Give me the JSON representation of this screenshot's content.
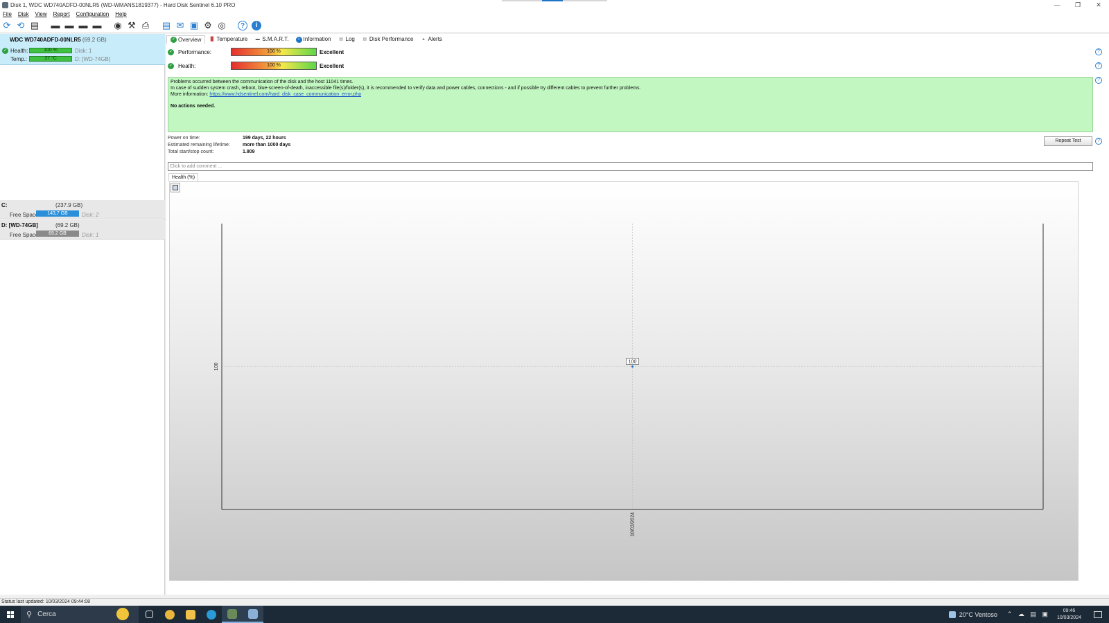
{
  "window": {
    "title": "Disk 1, WDC WD740ADFD-00NLR5 (WD-WMANS1819377) - Hard Disk Sentinel 6.10 PRO"
  },
  "menu": [
    "File",
    "Disk",
    "View",
    "Report",
    "Configuration",
    "Help"
  ],
  "disk": {
    "name": "WDC WD740ADFD-00NLR5",
    "size": "(69.2 GB)",
    "health_label": "Health:",
    "health_value": "100 %",
    "health_percent": 100,
    "disk_label": "Disk: 1",
    "temp_label": "Temp.:",
    "temp_value": "37 °C",
    "temp_drive": "D: [WD-74GB]"
  },
  "volumes": [
    {
      "name": "C:",
      "size": "(237.9 GB)",
      "free_label": "Free Space",
      "free_value": "143,7 GB",
      "disk": "Disk: 2",
      "bar_color": "#2a8fd8"
    },
    {
      "name": "D: [WD-74GB]",
      "size": "(69.2 GB)",
      "free_label": "Free Space",
      "free_value": "69,2 GB",
      "disk": "Disk: 1",
      "bar_color": "#8a8a8a"
    }
  ],
  "tabs": [
    {
      "label": "Overview",
      "icon": "check-icon",
      "color": "#2ea043"
    },
    {
      "label": "Temperature",
      "icon": "thermometer-icon",
      "color": "#c44"
    },
    {
      "label": "S.M.A.R.T.",
      "icon": "drive-icon",
      "color": "#555"
    },
    {
      "label": "Information",
      "icon": "info-icon",
      "color": "#1e74c8"
    },
    {
      "label": "Log",
      "icon": "log-icon",
      "color": "#888"
    },
    {
      "label": "Disk Performance",
      "icon": "performance-icon",
      "color": "#888"
    },
    {
      "label": "Alerts",
      "icon": "alert-icon",
      "color": "#888"
    }
  ],
  "overview": {
    "performance_label": "Performance:",
    "performance_bar": "100 %",
    "performance_percent": 100,
    "performance_text": "Excellent",
    "health_label": "Health:",
    "health_bar": "100 %",
    "health_percent": 100,
    "health_text": "Excellent",
    "message_line1": "Problems occurred between the communication of the disk and the host 11041 times.",
    "message_line2": "In case of sudden system crash, reboot, blue-screen-of-death, inaccessible file(s)/folder(s), it is recommended to verify data and power cables, connections - and if possible try different cables to prevent further problems.",
    "message_more_label": "More information:",
    "message_link": "https://www.hdsentinel.com/hard_disk_case_communication_error.php",
    "message_actions": "No actions needed.",
    "power_on_label": "Power on time:",
    "power_on_value": "199 days, 22 hours",
    "lifetime_label": "Estimated remaining lifetime:",
    "lifetime_value": "more than 1000 days",
    "startstop_label": "Total start/stop count:",
    "startstop_value": "1.809",
    "repeat_button": "Repeat Test",
    "comment_placeholder": "Click to add comment ..."
  },
  "chart_tab_label": "Health (%)",
  "chart_data": {
    "type": "line",
    "title": "",
    "xlabel": "",
    "ylabel": "",
    "x": [
      "10/03/2024"
    ],
    "series": [
      {
        "values": [
          100
        ]
      }
    ],
    "ytick_labels": [
      "100"
    ],
    "data_labels": [
      "100"
    ],
    "grid": true
  },
  "statusbar": {
    "text": "Status last updated: 10/03/2024 09:44:08"
  },
  "taskbar": {
    "search_placeholder": "Cerca",
    "weather": "20°C  Ventoso",
    "time": "09:46",
    "date": "10/03/2024",
    "apps": [
      {
        "name": "task-view-icon",
        "color": "#e6e6e6"
      },
      {
        "name": "chrome-icon",
        "color": "#e9b63b"
      },
      {
        "name": "file-explorer-icon",
        "color": "#f0c24a"
      },
      {
        "name": "edge-icon",
        "color": "#2a9ad8"
      },
      {
        "name": "hd-sentinel-task-icon",
        "color": "#6a8a5a"
      },
      {
        "name": "hd-sentinel-active-icon",
        "color": "#8ab0d8"
      }
    ]
  }
}
